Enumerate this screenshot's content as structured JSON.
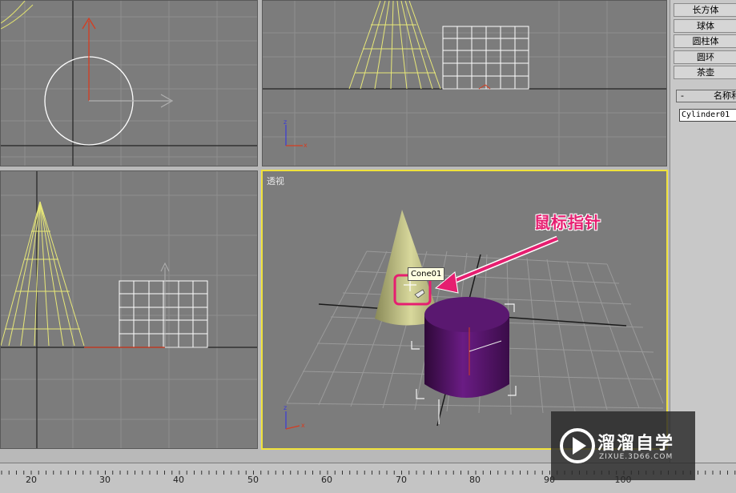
{
  "command_panel": {
    "object_types": [
      "长方体",
      "球体",
      "圆柱体",
      "圆环",
      "茶壶"
    ],
    "name_rollout": {
      "toggle": "-",
      "title": "名称和"
    },
    "name_field": "Cylinder01"
  },
  "viewports": {
    "perspective_label": "透视",
    "axis_x": "x",
    "axis_z": "z"
  },
  "tooltip": "Cone01",
  "annotation": {
    "callout": "鼠标指针",
    "color": "#e61e70"
  },
  "timeline": {
    "ticks": [
      "20",
      "30",
      "40",
      "50",
      "60",
      "70",
      "80",
      "90",
      "100"
    ]
  },
  "watermark": {
    "title": "溜溜自学",
    "url": "ZIXUE.3D66.COM"
  },
  "colors": {
    "active_border": "#f0e23c",
    "viewport_bg": "#7c7c7c",
    "cylinder": "#5a1870",
    "cone": "#c9c98c"
  }
}
